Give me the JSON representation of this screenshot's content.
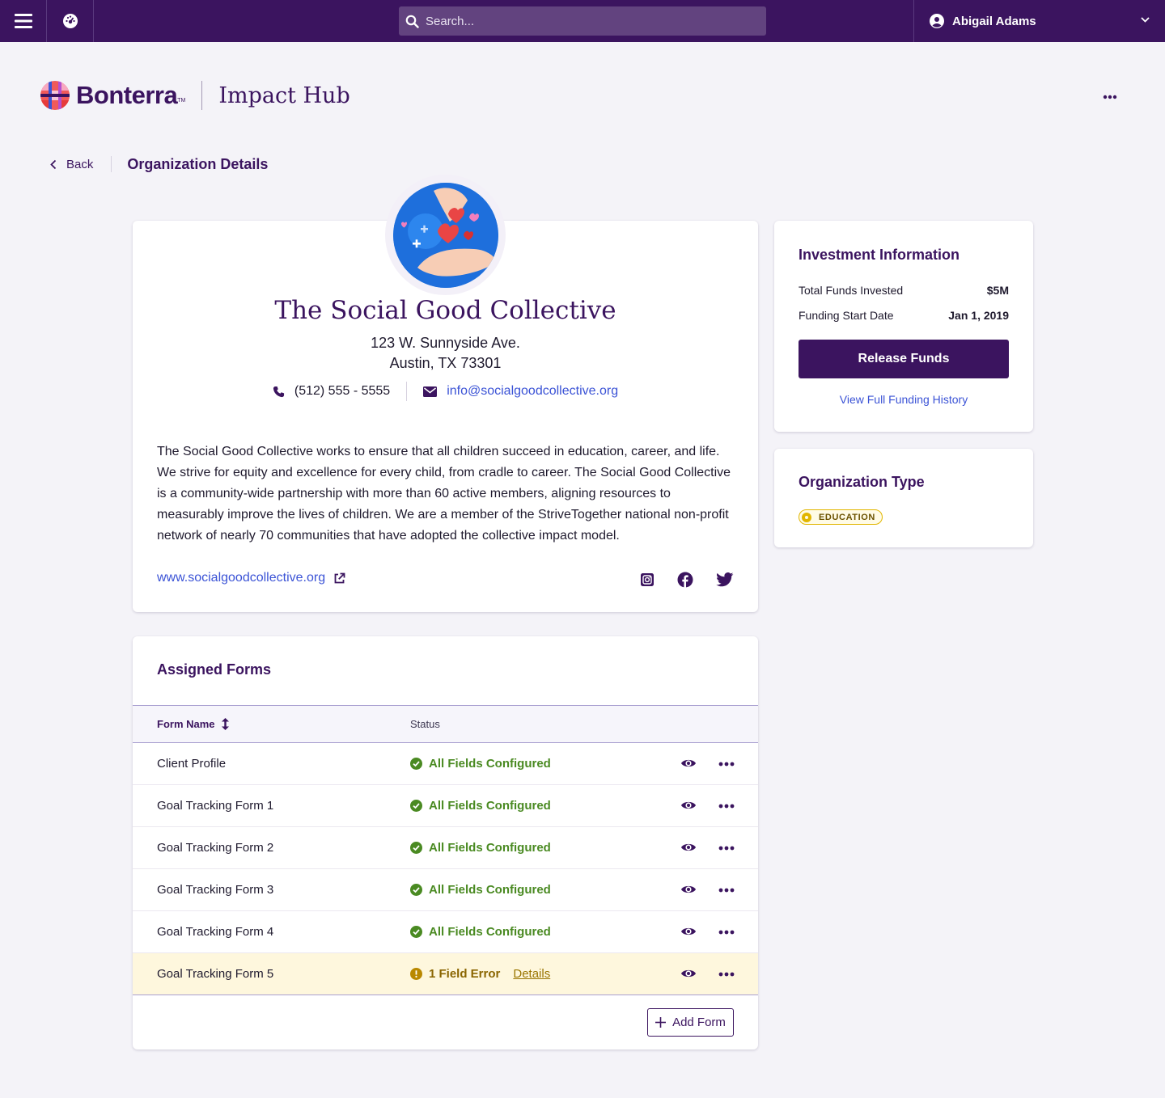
{
  "topbar": {
    "search_placeholder": "Search...",
    "user_name": "Abigail Adams"
  },
  "brand": {
    "name": "Bonterra",
    "trademark": "TM",
    "product": "Impact Hub"
  },
  "breadcrumb": {
    "back_label": "Back",
    "title": "Organization Details"
  },
  "organization": {
    "name": "The Social Good Collective",
    "address_line1": "123 W. Sunnyside Ave.",
    "address_line2": "Austin, TX 73301",
    "phone": "(512)  555 - 5555",
    "email": "info@socialgoodcollective.org",
    "description": "The Social Good Collective works to ensure that all children succeed in education, career, and life. We strive for equity and excellence for every child, from cradle to career. The Social Good Collective is a community-wide partnership with more than 60 active members, aligning resources to measurably improve the lives of children. We are a member of the StriveTogether national non-profit network of nearly 70 communities that have adopted the collective impact model.",
    "website": "www.socialgoodcollective.org",
    "socials": [
      "instagram-icon",
      "facebook-icon",
      "twitter-icon"
    ]
  },
  "forms": {
    "title": "Assigned Forms",
    "columns": {
      "name": "Form Name",
      "status": "Status"
    },
    "rows": [
      {
        "name": "Client Profile",
        "status": "All Fields Configured",
        "state": "ok"
      },
      {
        "name": "Goal Tracking Form 1",
        "status": "All Fields Configured",
        "state": "ok"
      },
      {
        "name": "Goal Tracking Form 2",
        "status": "All Fields Configured",
        "state": "ok"
      },
      {
        "name": "Goal Tracking Form 3",
        "status": "All Fields Configured",
        "state": "ok"
      },
      {
        "name": "Goal Tracking Form 4",
        "status": "All Fields Configured",
        "state": "ok"
      },
      {
        "name": "Goal Tracking Form 5",
        "status": "1 Field Error",
        "state": "error",
        "details_label": "Details"
      }
    ],
    "add_label": "Add Form"
  },
  "investment": {
    "title": "Investment Information",
    "total_label": "Total Funds Invested",
    "total_value": "$5M",
    "start_label": "Funding Start Date",
    "start_value": "Jan 1, 2019",
    "release_label": "Release Funds",
    "history_label": "View Full Funding History"
  },
  "org_type": {
    "title": "Organization Type",
    "badge": "EDUCATION"
  },
  "colors": {
    "brand": "#3b145f",
    "link": "#3b53d6",
    "success": "#4a8a22",
    "warning": "#e1b600",
    "error_row_bg": "#fef7dd"
  }
}
